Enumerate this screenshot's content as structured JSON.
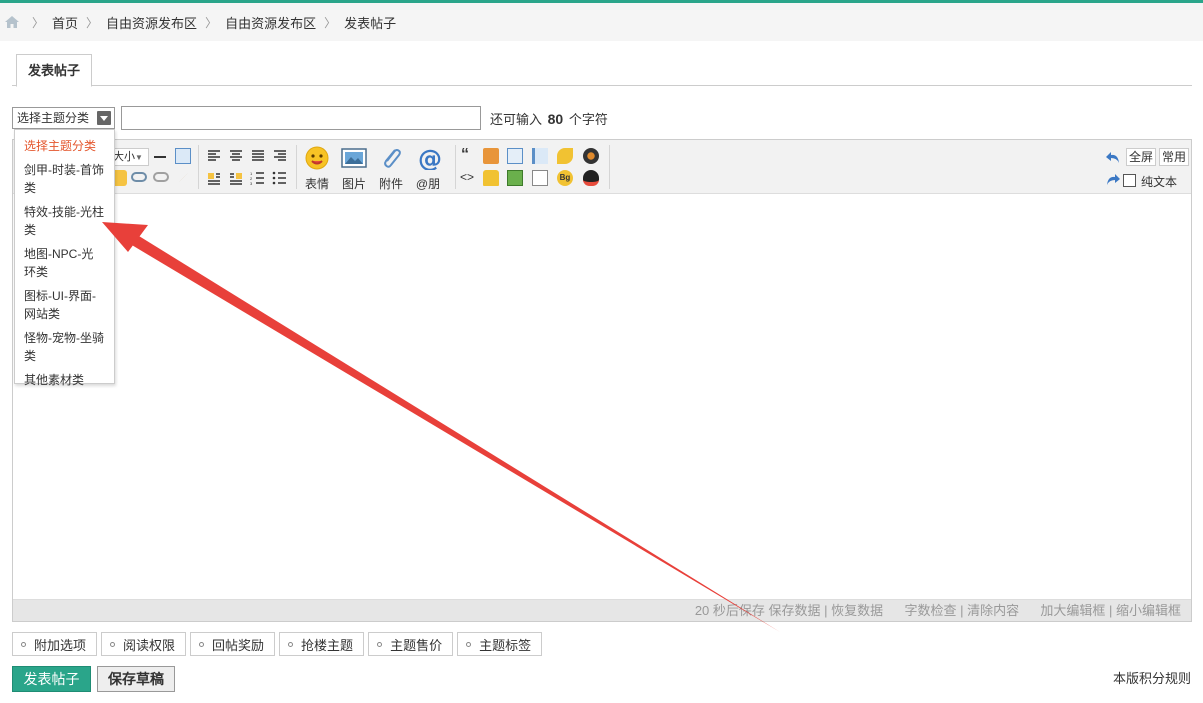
{
  "breadcrumb": {
    "items": [
      "首页",
      "自由资源发布区",
      "自由资源发布区",
      "发表帖子"
    ]
  },
  "tab": {
    "label": "发表帖子"
  },
  "title_row": {
    "category_selected": "选择主题分类",
    "remain_prefix": "还可输入",
    "remain_count": "80",
    "remain_suffix": "个字符"
  },
  "dropdown": {
    "options": [
      "选择主题分类",
      "剑甲-时装-首饰类",
      "特效-技能-光柱类",
      "地图-NPC-光环类",
      "图标-UI-界面-网站类",
      "怪物-宠物-坐骑类",
      "其他素材类"
    ]
  },
  "toolbar": {
    "font_size": "大小",
    "big_buttons": [
      "表情",
      "图片",
      "附件",
      "@朋"
    ],
    "fullscreen": "全屏",
    "common": "常用",
    "plain_text": "纯文本"
  },
  "statusbar": {
    "autosave": "20 秒后保存",
    "save_data": "保存数据",
    "restore_data": "恢复数据",
    "word_check": "字数检查",
    "clear": "清除内容",
    "enlarge": "加大编辑框",
    "shrink": "缩小编辑框"
  },
  "extra_options": [
    "附加选项",
    "阅读权限",
    "回帖奖励",
    "抢楼主题",
    "主题售价",
    "主题标签"
  ],
  "actions": {
    "post": "发表帖子",
    "save_draft": "保存草稿",
    "rules": "本版积分规则"
  },
  "colors": {
    "accent": "#2aa58a",
    "annotation_arrow": "#e8403a",
    "selected_option": "#e4572e"
  },
  "icons": [
    "home-icon",
    "dropdown-arrow-icon",
    "smiley-icon",
    "image-icon",
    "paperclip-icon",
    "at-icon",
    "undo-icon",
    "redo-icon"
  ]
}
